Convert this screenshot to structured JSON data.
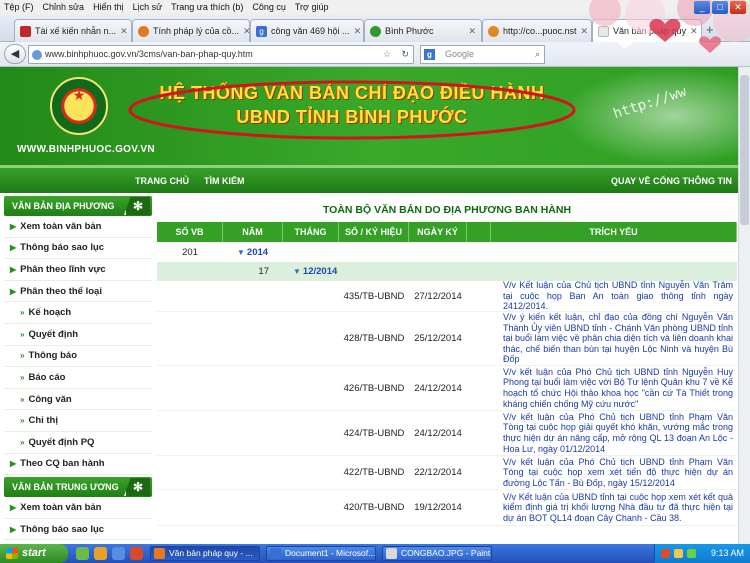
{
  "menu": [
    "Tệp (F)",
    "Chỉnh sửa",
    "Hiển thị",
    "Lịch sử",
    "Trang ưa thích (b)",
    "Công cụ",
    "Trợ giúp"
  ],
  "tabs": [
    {
      "label": "Tài xế kiến nhẫn n...",
      "color": "#c0282a"
    },
    {
      "label": "Tính pháp lý của cồ...",
      "color": "#e07a1e"
    },
    {
      "label": "công văn 469 hội ...",
      "color": "#3a6fd8"
    },
    {
      "label": "Bình Phước",
      "color": "#2f9a2a"
    },
    {
      "label": "http://co...puoc.nst",
      "color": "#e08a1e"
    },
    {
      "label": "Văn bản pháp quy",
      "color": "#e8e8e8"
    }
  ],
  "address": {
    "url": "www.binhphuoc.gov.vn/3cms/van-ban-phap-quy.htm",
    "search_placeholder": "Google"
  },
  "header": {
    "title_line1": "HỆ THỐNG VĂN BẢN CHỈ ĐẠO ĐIỀU HÀNH",
    "title_line2": "UBND TỈNH BÌNH PHƯỚC",
    "site_url": "WWW.BINHPHUOC.GOV.VN",
    "deco_text": "http://ww"
  },
  "nav": {
    "home": "TRANG CHỦ",
    "search": "TÌM KIẾM",
    "portal": "QUAY VỀ CỔNG THÔNG TIN"
  },
  "sidebar": {
    "section1": "VĂN BẢN ĐỊA PHƯƠNG",
    "items1": [
      {
        "label": "Xem toàn văn bản",
        "sub": false
      },
      {
        "label": "Thông báo sao lục",
        "sub": false
      },
      {
        "label": "Phân theo lĩnh vực",
        "sub": false
      },
      {
        "label": "Phân theo thể loại",
        "sub": false
      },
      {
        "label": "Kế hoạch",
        "sub": true
      },
      {
        "label": "Quyết định",
        "sub": true
      },
      {
        "label": "Thông báo",
        "sub": true
      },
      {
        "label": "Báo cáo",
        "sub": true
      },
      {
        "label": "Công văn",
        "sub": true
      },
      {
        "label": "Chỉ thị",
        "sub": true
      },
      {
        "label": "Quyết định PQ",
        "sub": true
      },
      {
        "label": "Theo CQ ban hành",
        "sub": false
      }
    ],
    "section2": "VĂN BẢN TRUNG ƯƠNG",
    "items2": [
      {
        "label": "Xem toàn văn bản"
      },
      {
        "label": "Thông báo sao lục"
      }
    ]
  },
  "content": {
    "title": "TOÀN BỘ VĂN BẢN DO ĐỊA PHƯƠNG BAN HÀNH",
    "columns": [
      "SỐ VB",
      "NĂM",
      "THÁNG",
      "SỐ / KÝ HIỆU",
      "NGÀY KÝ",
      "",
      "TRÍCH YẾU"
    ],
    "year_count": "201",
    "year": "2014",
    "month_count": "17",
    "month": "12/2014",
    "rows": [
      {
        "number": "435/TB-UBND",
        "date": "27/12/2014",
        "summary": "V/v Kết luận của Chủ tịch UBND tỉnh Nguyễn Văn Trăm tại cuộc họp Ban An toàn giao thông tỉnh ngày 2412/2014."
      },
      {
        "number": "428/TB-UBND",
        "date": "25/12/2014",
        "summary": "V/v ý kiến kết luận, chỉ đạo của đồng chí Nguyễn Văn Thành Ủy viên UBND tỉnh - Chánh Văn phòng UBND tỉnh tại buổi làm việc về phân chia diện tích và liên doanh khai thác, chế biến than bùn tại huyện Lộc Ninh và huyện Bù Đốp"
      },
      {
        "number": "426/TB-UBND",
        "date": "24/12/2014",
        "summary": "V/v kết luận của Phó Chủ tịch UBND tỉnh Nguyễn Huy Phong tại buổi làm việc với Bộ Tư lệnh Quân khu 7 về Kế hoạch tổ chức Hội thảo khoa học \"cần cứ Tà Thiết trong kháng chiến chống Mỹ cứu nước\""
      },
      {
        "number": "424/TB-UBND",
        "date": "24/12/2014",
        "summary": "V/v kết luận của Phó Chủ tịch UBND tỉnh Phạm Văn Tòng tại cuộc họp giải quyết khó khăn, vướng mắc trong thực hiện dự án nâng cấp, mở rộng QL 13 đoạn An Lộc - Hoa Lư, ngày 01/12/2014"
      },
      {
        "number": "422/TB-UBND",
        "date": "22/12/2014",
        "summary": "V/v kết luận của Phó Chủ tịch UBND tỉnh Phạm Văn Tòng tại cuộc họp xem xét tiến độ thực hiện dự án đường Lộc Tấn - Bù Đốp, ngày 15/12/2014"
      },
      {
        "number": "420/TB-UBND",
        "date": "19/12/2014",
        "summary": "V/v Kết luận của UBND tỉnh tại cuộc họp xem xét kết quả kiểm định giá trị khối lượng Nhà đầu tư đã thực hiện tại dự án BOT QL14 đoạn Cây Chanh - Cầu 38."
      }
    ]
  },
  "taskbar": {
    "start": "start",
    "tasks": [
      {
        "label": "Văn bản pháp quy - ...",
        "color": "#e87a1e"
      },
      {
        "label": "Document1 - Microsof...",
        "color": "#3a6fd8"
      },
      {
        "label": "CONGBAO.JPG - Paint",
        "color": "#d8d8d8"
      }
    ],
    "time": "9:13 AM"
  }
}
